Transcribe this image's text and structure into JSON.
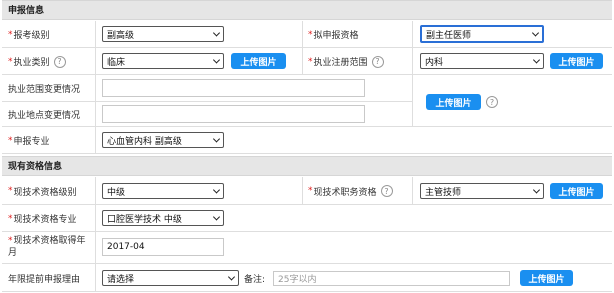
{
  "sections": {
    "apply_info": "申报信息",
    "current_qual": "现有资格信息"
  },
  "fields": {
    "exam_level": {
      "label": "报考级别",
      "value": "副高级"
    },
    "apply_qual": {
      "label": "拟申报资格",
      "value": "副主任医师"
    },
    "practice_type": {
      "label": "执业类别",
      "value": "临床"
    },
    "practice_scope": {
      "label": "执业注册范围",
      "value": "内科"
    },
    "scope_change": {
      "label": "执业范围变更情况",
      "value": ""
    },
    "location_change": {
      "label": "执业地点变更情况",
      "value": ""
    },
    "apply_major": {
      "label": "申报专业",
      "value": "心血管内科 副高级"
    },
    "tech_level": {
      "label": "现技术资格级别",
      "value": "中级"
    },
    "tech_post": {
      "label": "现技术职务资格",
      "value": "主管技师"
    },
    "tech_major": {
      "label": "现技术资格专业",
      "value": "口腔医学技术 中级"
    },
    "tech_year": {
      "label_line1": "现技术资格取得年",
      "label_line2": "月",
      "value": "2017-04"
    },
    "early_reason": {
      "label": "年限提前申报理由",
      "value": "请选择",
      "remark_label": "备注:",
      "remark_placeholder": "25字以内"
    }
  },
  "buttons": {
    "upload": "上传图片"
  },
  "icons": {
    "help": "help-icon",
    "required": "*"
  },
  "colors": {
    "required": "#e02020",
    "button": "#1a8ff0",
    "focus_border": "#2a6fd6"
  }
}
